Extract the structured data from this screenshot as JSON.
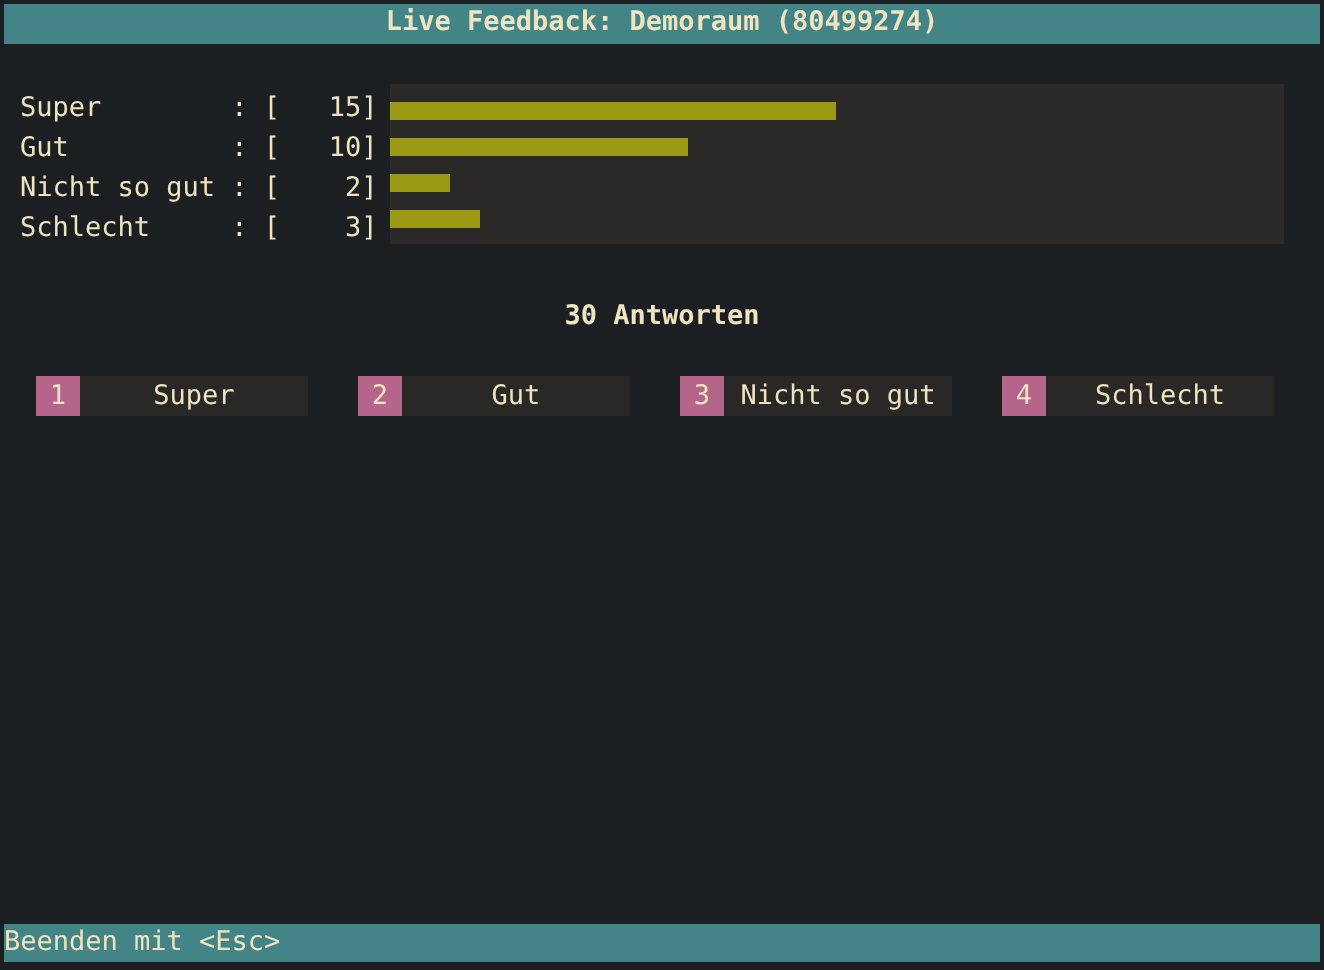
{
  "title": "Live Feedback: Demoraum (80499274)",
  "results": [
    {
      "line": "Super        : [   15]",
      "level": 0.5
    },
    {
      "line": "Gut          : [   10]",
      "level": 0.333
    },
    {
      "line": "Nicht so gut : [    2]",
      "level": 0.067
    },
    {
      "line": "Schlecht     : [    3]",
      "level": 0.1
    }
  ],
  "total": "30 Antworten",
  "options": [
    {
      "key": "1",
      "label": "Super"
    },
    {
      "key": "2",
      "label": "Gut"
    },
    {
      "key": "3",
      "label": "Nicht so gut"
    },
    {
      "key": "4",
      "label": "Schlecht"
    }
  ],
  "status_bar": "Beenden mit <Esc>"
}
